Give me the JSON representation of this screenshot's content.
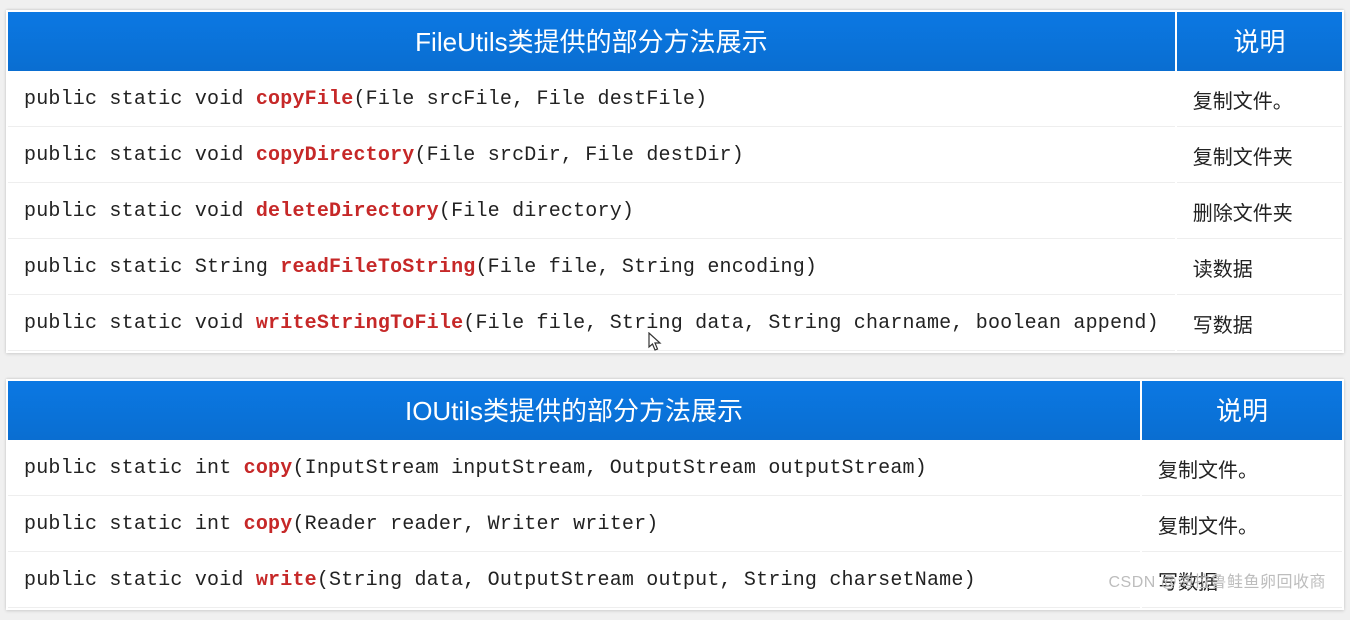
{
  "tables": [
    {
      "header_method": "FileUtils类提供的部分方法展示",
      "header_desc": "说明",
      "rows": [
        {
          "pre": "public static void ",
          "method": "copyFile",
          "post": "(File srcFile, File destFile)",
          "desc": "复制文件。"
        },
        {
          "pre": "public static void ",
          "method": "copyDirectory",
          "post": "(File srcDir, File destDir)",
          "desc": "复制文件夹"
        },
        {
          "pre": "public static void ",
          "method": "deleteDirectory",
          "post": "(File directory)",
          "desc": "删除文件夹"
        },
        {
          "pre": "public static String ",
          "method": "readFileToString",
          "post": "(File file, String encoding)",
          "desc": "读数据"
        },
        {
          "pre": "public static void ",
          "method": "writeStringToFile",
          "post": "(File file, String data, String charname, boolean append)",
          "desc": "写数据"
        }
      ]
    },
    {
      "header_method": "IOUtils类提供的部分方法展示",
      "header_desc": "说明",
      "rows": [
        {
          "pre": "public static int ",
          "method": "copy",
          "post": "(InputStream inputStream, OutputStream outputStream)",
          "desc": "复制文件。"
        },
        {
          "pre": "public static int ",
          "method": "copy",
          "post": "(Reader reader, Writer writer)",
          "desc": "复制文件。"
        },
        {
          "pre": "public static void ",
          "method": "write",
          "post": "(String data, OutputStream output, String charsetName)",
          "desc": "写数据"
        }
      ]
    }
  ],
  "watermark": "CSDN @海拉鲁鲑鱼卵回收商"
}
